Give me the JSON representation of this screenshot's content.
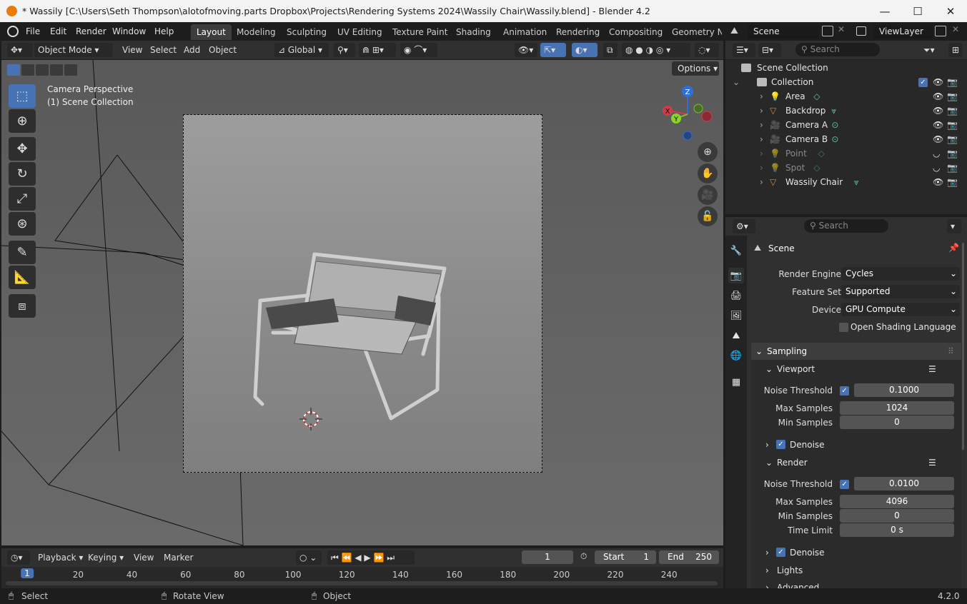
{
  "window": {
    "title": "* Wassily [C:\\Users\\Seth Thompson\\alotofmoving.parts Dropbox\\Projects\\Rendering Systems 2024\\Wassily Chair\\Wassily.blend] - Blender 4.2",
    "minimize": "—",
    "maximize": "☐",
    "close": "✕"
  },
  "menu": [
    "File",
    "Edit",
    "Render",
    "Window",
    "Help"
  ],
  "workspaces": [
    "Layout",
    "Modeling",
    "Sculpting",
    "UV Editing",
    "Texture Paint",
    "Shading",
    "Animation",
    "Rendering",
    "Compositing",
    "Geometry No"
  ],
  "scene_selector": {
    "scene": "Scene",
    "view_layer": "ViewLayer"
  },
  "viewport_header": {
    "mode": "Object Mode",
    "view": "View",
    "select": "Select",
    "add": "Add",
    "object": "Object",
    "orientation": "Global",
    "options": "Options"
  },
  "viewport": {
    "overlay_line1": "Camera Perspective",
    "overlay_line2": "(1) Scene Collection",
    "gizmo": {
      "x": "X",
      "y": "Y",
      "z": "Z"
    }
  },
  "outliner": {
    "search_placeholder": "Search",
    "root": "Scene Collection",
    "collection": "Collection",
    "items": [
      {
        "name": "Area",
        "type": "light",
        "visible": true
      },
      {
        "name": "Backdrop",
        "type": "mesh",
        "visible": true
      },
      {
        "name": "Camera A",
        "type": "camera",
        "visible": true
      },
      {
        "name": "Camera B",
        "type": "camera",
        "visible": true
      },
      {
        "name": "Point",
        "type": "light",
        "visible": false
      },
      {
        "name": "Spot",
        "type": "light",
        "visible": false
      },
      {
        "name": "Wassily Chair",
        "type": "mesh",
        "visible": true
      }
    ]
  },
  "properties": {
    "search_placeholder": "Search",
    "context": "Scene",
    "render_engine_label": "Render Engine",
    "render_engine": "Cycles",
    "feature_set_label": "Feature Set",
    "feature_set": "Supported",
    "device_label": "Device",
    "device": "GPU Compute",
    "osl_label": "Open Shading Language",
    "sampling": "Sampling",
    "viewport": {
      "title": "Viewport",
      "noise_threshold_label": "Noise Threshold",
      "noise_threshold": "0.1000",
      "max_samples_label": "Max Samples",
      "max_samples": "1024",
      "min_samples_label": "Min Samples",
      "min_samples": "0",
      "denoise": "Denoise"
    },
    "render": {
      "title": "Render",
      "noise_threshold_label": "Noise Threshold",
      "noise_threshold": "0.0100",
      "max_samples_label": "Max Samples",
      "max_samples": "4096",
      "min_samples_label": "Min Samples",
      "min_samples": "0",
      "time_limit_label": "Time Limit",
      "time_limit": "0 s",
      "denoise": "Denoise"
    },
    "lights": "Lights",
    "advanced": "Advanced"
  },
  "timeline": {
    "playback": "Playback",
    "keying": "Keying",
    "view": "View",
    "marker": "Marker",
    "current_frame": "1",
    "start_label": "Start",
    "start": "1",
    "end_label": "End",
    "end": "250",
    "ticks": [
      "1",
      "20",
      "40",
      "60",
      "80",
      "100",
      "120",
      "140",
      "160",
      "180",
      "200",
      "220",
      "240"
    ]
  },
  "statusbar": {
    "select": "Select",
    "rotate": "Rotate View",
    "object": "Object",
    "version": "4.2.0"
  }
}
